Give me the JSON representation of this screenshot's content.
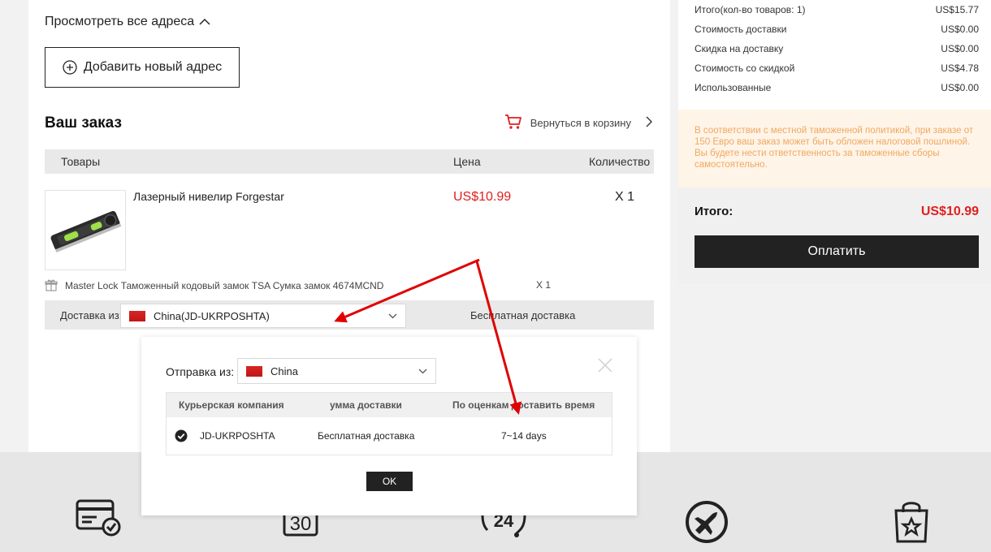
{
  "address": {
    "view_all": "Просмотреть все адреса",
    "add_new": "Добавить новый адрес"
  },
  "order": {
    "title": "Ваш заказ",
    "back_to_cart": "Вернуться в корзину",
    "columns": {
      "goods": "Товары",
      "price": "Цена",
      "quantity": "Количество"
    },
    "product": {
      "name": "Лазерный нивелир Forgestar",
      "price": "US$10.99",
      "qty": "X 1"
    },
    "gift": {
      "name": "Master Lock Таможенный кодовый замок TSA Сумка замок 4674MCND",
      "qty": "X 1"
    },
    "shipping": {
      "from_label": "Доставка из:",
      "from_value": "China(JD-UKRPOSHTA)",
      "cost": "Бесплатная доставка"
    }
  },
  "summary": {
    "rows": [
      {
        "label": "Итого(кол-во товаров: 1)",
        "value": "US$15.77"
      },
      {
        "label": "Стоимость доставки",
        "value": "US$0.00"
      },
      {
        "label": "Скидка на доставку",
        "value": "US$0.00"
      },
      {
        "label": "Стоимость со скидкой",
        "value": "US$4.78"
      },
      {
        "label": "Использованные",
        "value": "US$0.00"
      }
    ],
    "notice": "В соответствии с местной таможенной политикой, при заказе от 150 Евро ваш заказ может быть обложен налоговой пошлиной. Вы будете нести ответственность за таможенные сборы самостоятельно.",
    "total_label": "Итого:",
    "total_value": "US$10.99",
    "pay_button": "Оплатить"
  },
  "modal": {
    "from_label": "Отправка из:",
    "from_value": "China",
    "columns": {
      "courier": "Курьерская компания",
      "cost": "умма доставки",
      "time": "По оценкам доставить время"
    },
    "row": {
      "courier": "JD-UKRPOSHTA",
      "cost": "Бесплатная доставка",
      "time": "7~14 days"
    },
    "ok_button": "OK"
  },
  "footer": {
    "badge_30": "30",
    "badge_24": "24"
  },
  "colors": {
    "price_red": "#e02020",
    "annotation_red": "#e00000",
    "notice_text": "#f0a860",
    "notice_bg": "#fff4e8"
  },
  "icons": [
    "chevron-up-icon",
    "plus-circle-icon",
    "cart-icon",
    "chevron-right-icon",
    "gift-icon",
    "flag-china-icon",
    "chevron-down-icon",
    "close-icon",
    "check-circle-icon",
    "credit-card-check-icon",
    "calendar-30-icon",
    "clock-24-icon",
    "airplane-icon",
    "shopping-bag-star-icon"
  ]
}
